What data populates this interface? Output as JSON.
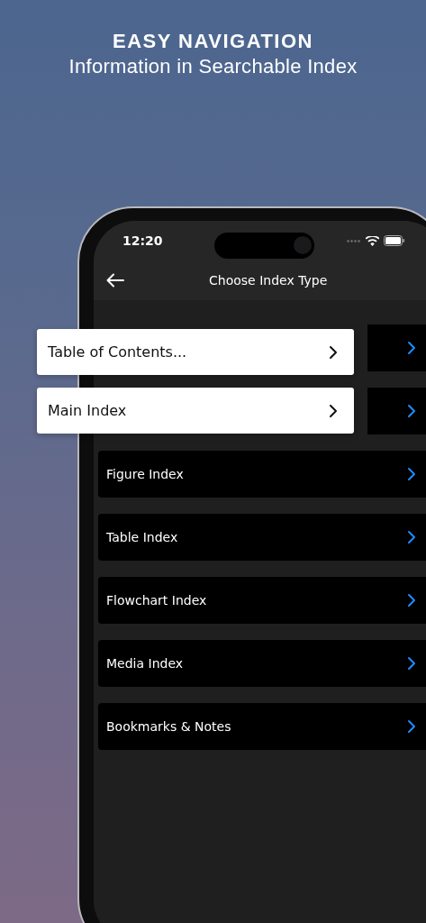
{
  "headline": {
    "title": "EASY NAVIGATION",
    "subtitle": "Information in Searchable Index"
  },
  "status_bar": {
    "time": "12:20"
  },
  "nav_bar": {
    "title": "Choose Index Type"
  },
  "index_items": [
    {
      "kind": "covered"
    },
    {
      "kind": "covered"
    },
    {
      "label": "Figure Index"
    },
    {
      "label": "Table Index"
    },
    {
      "label": "Flowchart Index"
    },
    {
      "label": "Media Index"
    },
    {
      "label": "Bookmarks & Notes"
    }
  ],
  "callouts": [
    {
      "label": "Table of Contents..."
    },
    {
      "label": "Main Index"
    }
  ]
}
